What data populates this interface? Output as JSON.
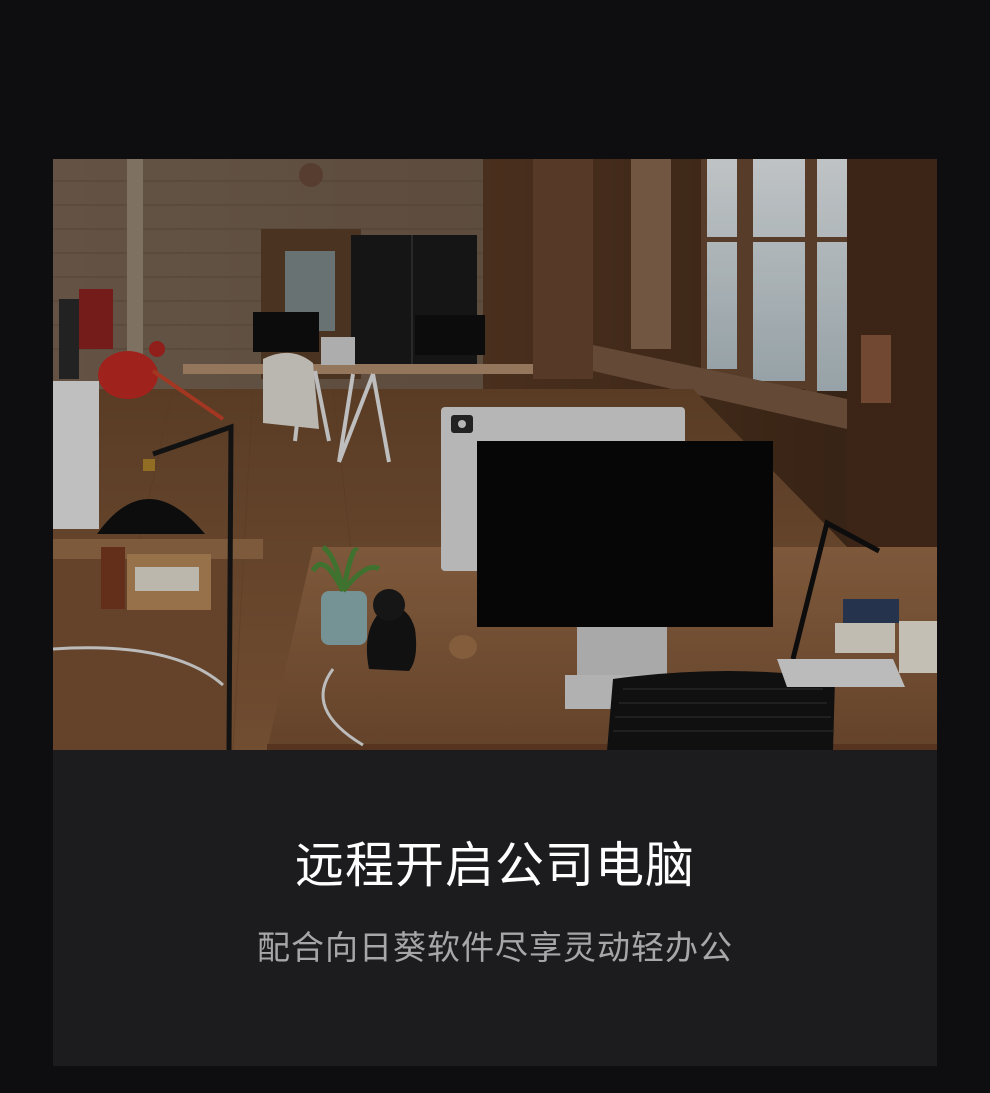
{
  "banner": {
    "image_icon": "office-photo",
    "title": "远程开启公司电脑",
    "subtitle": "配合向日葵软件尽享灵动轻办公"
  },
  "colors": {
    "page_background": "#0e0e10",
    "card_background": "#1c1c1e",
    "title_color": "#ffffff",
    "subtitle_color": "#a7a7aa"
  }
}
